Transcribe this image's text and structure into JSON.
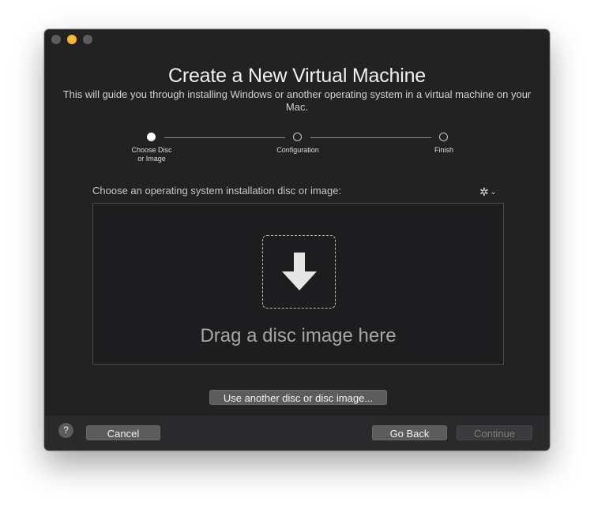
{
  "window": {
    "title": "Create a New Virtual Machine",
    "subtitle": "This will guide you through installing Windows or another operating system in a virtual machine on your Mac."
  },
  "steps": [
    {
      "label": "Choose Disc\nor Image",
      "active": true
    },
    {
      "label": "Configuration",
      "active": false
    },
    {
      "label": "Finish",
      "active": false
    }
  ],
  "main": {
    "choose_label": "Choose an operating system installation disc or image:",
    "settings_icon": "gear-icon",
    "drop_text": "Drag a disc image here",
    "drop_icon": "down-arrow-icon",
    "use_other_button": "Use another disc or disc image..."
  },
  "footer": {
    "help_label": "?",
    "cancel_label": "Cancel",
    "go_back_label": "Go Back",
    "continue_label": "Continue"
  },
  "colors": {
    "window_bg": "#222222",
    "active_light": "#f5b73a",
    "button_bg": "#5c5c5c",
    "disabled_text": "#7d7d7d"
  }
}
